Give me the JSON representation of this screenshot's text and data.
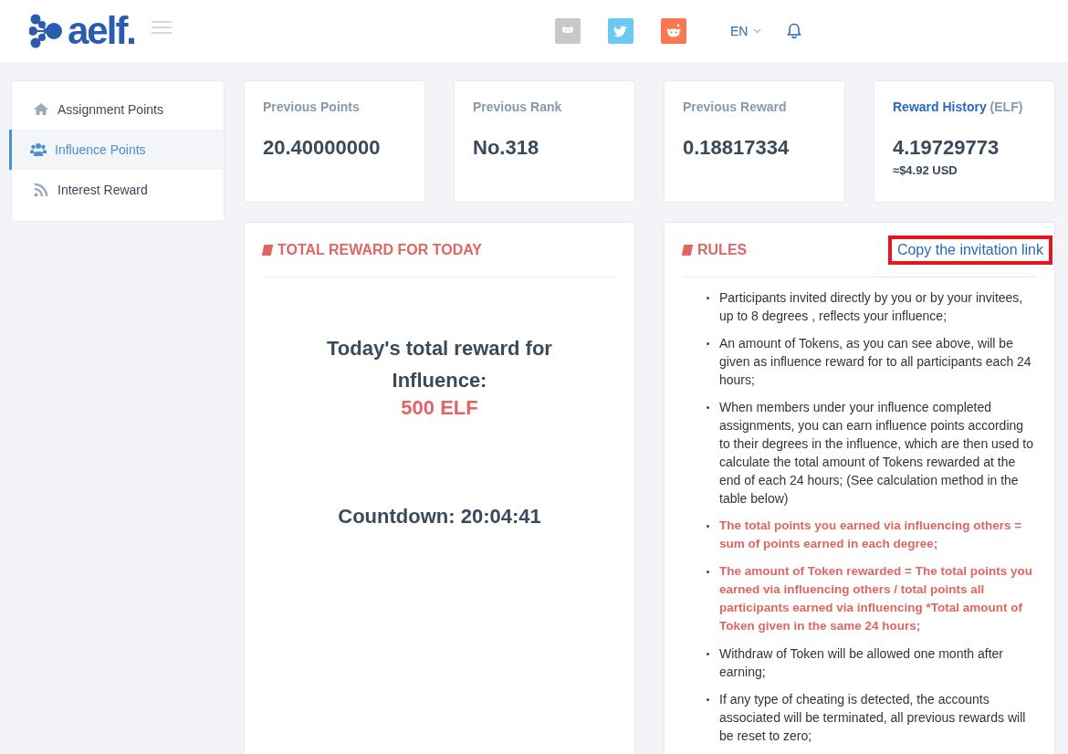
{
  "header": {
    "logo": "aelf.",
    "social": [
      {
        "kind": "github",
        "color": "#c8c8c8"
      },
      {
        "kind": "twitter",
        "color": "#6ccaf0"
      },
      {
        "kind": "reddit",
        "color": "#fa7850"
      }
    ],
    "language": "EN"
  },
  "sidebar": {
    "items": [
      {
        "label": "Assignment Points",
        "selected": false
      },
      {
        "label": "Influence Points",
        "selected": true
      },
      {
        "label": "Interest Reward",
        "selected": false
      }
    ]
  },
  "stats": [
    {
      "title": "Previous Points",
      "value": "20.40000000",
      "kind": "plain"
    },
    {
      "title": "Previous Rank",
      "value": "No.318",
      "kind": "plain"
    },
    {
      "title": "Previous Reward",
      "value": "0.18817334",
      "kind": "plain"
    },
    {
      "title": "Reward History",
      "unit": "(ELF)",
      "value": "4.19729773",
      "sub": "≈$4.92 USD",
      "kind": "link"
    }
  ],
  "reward_panel": {
    "heading": "TOTAL REWARD FOR TODAY",
    "lines": [
      "Today's total reward for",
      "Influence:"
    ],
    "amount": "500 ELF",
    "countdown": "Countdown: 20:04:41"
  },
  "rules_panel": {
    "heading": "RULES",
    "link": {
      "label": "Copy the invitation link",
      "highlighted": true
    },
    "items": [
      {
        "text": "Participants invited directly by you or by your invitees, up to 8 degrees , reflects your influence;",
        "kind": "normal"
      },
      {
        "text": "An amount of Tokens, as you can see above, will be given as influence reward for to all participants each 24 hours;",
        "kind": "normal"
      },
      {
        "text": "When members under your influence completed assignments, you can earn influence points according to their degrees in the influence, which are then used to calculate the total amount of Tokens rewarded at the end of each 24 hours; (See calculation method in the table below)",
        "kind": "normal"
      },
      {
        "text": "The total points you earned via influencing others = sum of points earned in each degree;",
        "kind": "emphasis"
      },
      {
        "text": "The amount of Token rewarded = The total points you earned via influencing others / total points all participants earned via influencing *Total amount of Token given in the same 24 hours;",
        "kind": "emphasis"
      },
      {
        "text": "Withdraw of Token will be allowed one month after earning;",
        "kind": "normal"
      },
      {
        "text": "If any type of cheating is detected, the accounts associated will be terminated, all previous rewards will be reset to zero;",
        "kind": "normal"
      }
    ]
  }
}
